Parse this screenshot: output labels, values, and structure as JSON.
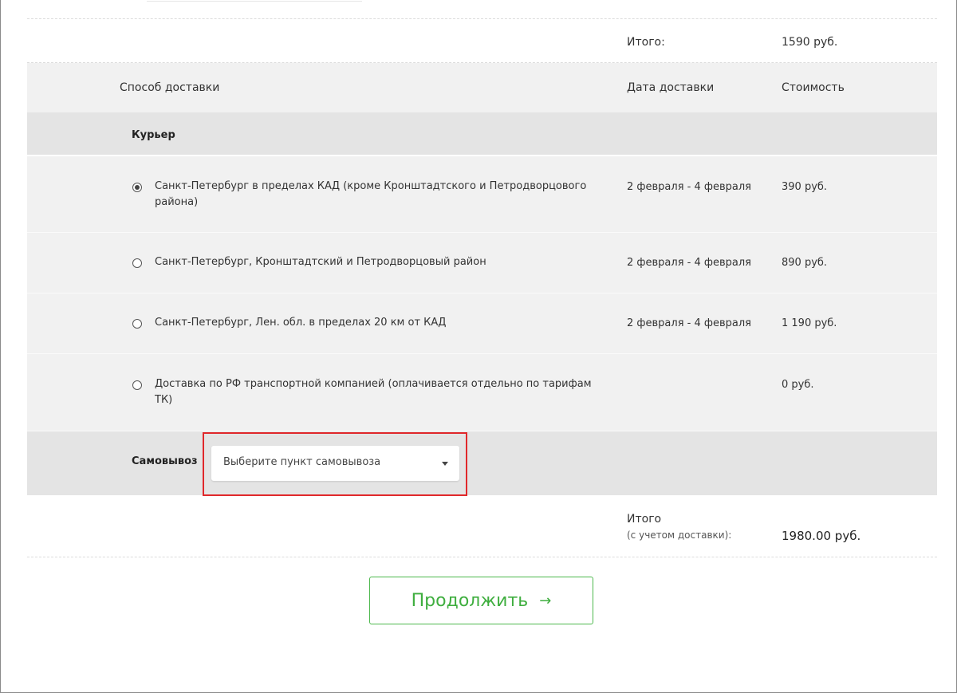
{
  "order_total": {
    "label": "Итого:",
    "value": "1590 руб."
  },
  "table_header": {
    "method": "Способ доставки",
    "date": "Дата доставки",
    "cost": "Стоимость"
  },
  "courier": {
    "title": "Курьер",
    "options": [
      {
        "label": "Санкт-Петербург в пределах КАД (кроме Кронштадтского и Петродворцового района)",
        "date": "2 февраля - 4 февраля",
        "cost": "390 руб.",
        "selected": true
      },
      {
        "label": "Санкт-Петербург, Кронштадтский и Петродворцовый район",
        "date": "2 февраля - 4 февраля",
        "cost": "890 руб.",
        "selected": false
      },
      {
        "label": "Санкт-Петербург, Лен. обл. в пределах 20 км от КАД",
        "date": "2 февраля - 4 февраля",
        "cost": "1 190 руб.",
        "selected": false
      },
      {
        "label": "Доставка по РФ транспортной компанией (оплачивается отдельно по тарифам ТК)",
        "date": "",
        "cost": "0 руб.",
        "selected": false
      }
    ]
  },
  "pickup": {
    "title": "Самовывоз",
    "select_value": "Выберите пункт самовывоза"
  },
  "grand_total": {
    "label": "Итого",
    "sublabel": "(с учетом доставки):",
    "value": "1980.00 руб."
  },
  "continue_button": {
    "label": "Продолжить",
    "arrow": "→"
  },
  "colors": {
    "accent": "#3fae3f",
    "highlight": "#e0282b",
    "row_bg": "#f1f1f1",
    "section_bg": "#e4e4e4"
  }
}
